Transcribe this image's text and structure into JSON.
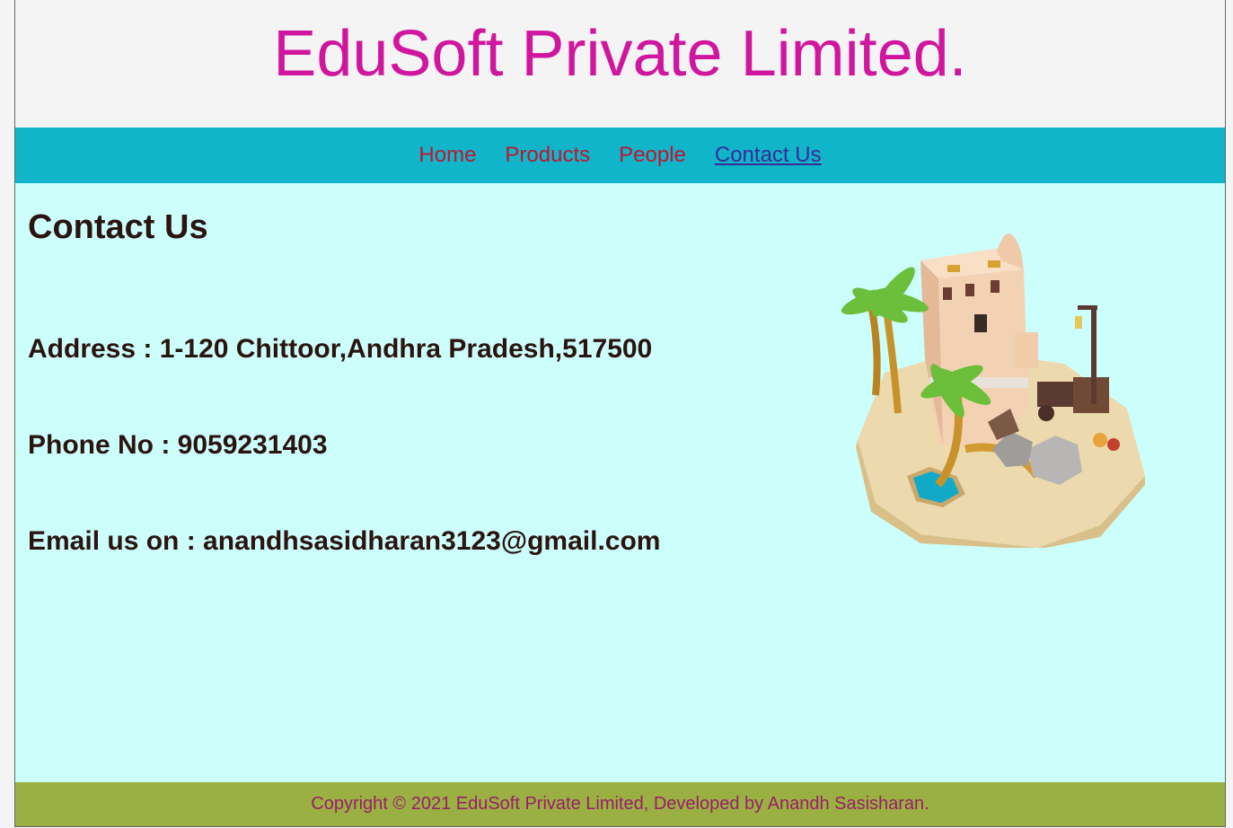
{
  "header": {
    "title": "EduSoft Private Limited."
  },
  "nav": {
    "items": [
      {
        "label": "Home"
      },
      {
        "label": "Products"
      },
      {
        "label": "People"
      },
      {
        "label": "Contact Us"
      }
    ]
  },
  "main": {
    "heading": "Contact Us",
    "address": "Address : 1-120 Chittoor,Andhra Pradesh,517500",
    "phone": "Phone No : 9059231403",
    "email": "Email us on : anandhsasidharan3123@gmail.com",
    "illustration_icon": "desert-island-tower-illustration"
  },
  "footer": {
    "text": "Copyright © 2021 EduSoft Private Limited, Developed by Anandh Sasisharan."
  },
  "colors": {
    "title": "#d0169e",
    "navbar": "#10b5ca",
    "nav_link": "#c0152f",
    "nav_active": "#3a2a99",
    "content_bg": "#ccfffc",
    "text": "#2b1310",
    "footer_bg": "#9bb042",
    "footer_text": "#9a1d6b"
  }
}
